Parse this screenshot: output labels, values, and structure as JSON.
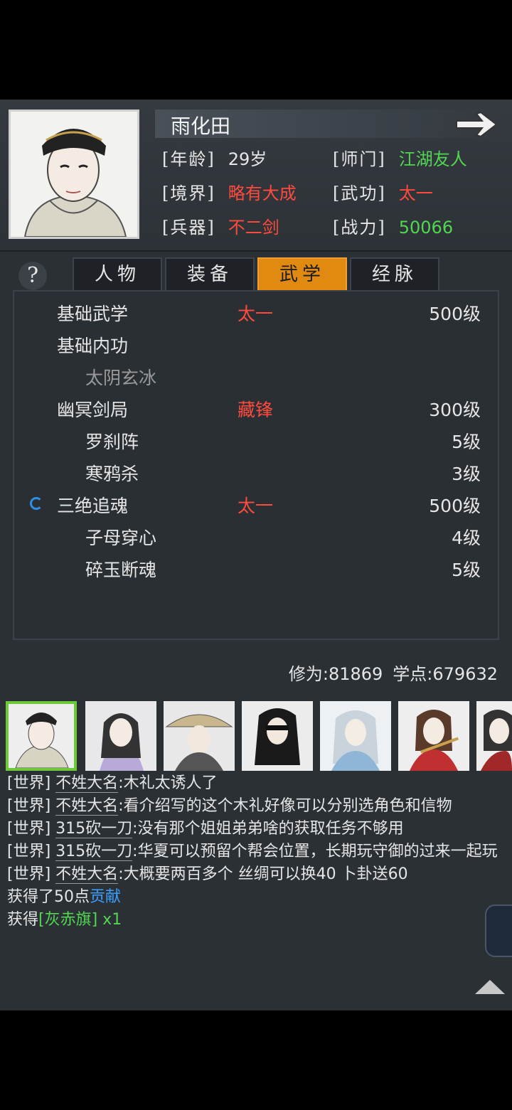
{
  "character": {
    "name": "雨化田",
    "age_label": "[年龄]",
    "age": "29岁",
    "sect_label": "[师门]",
    "sect": "江湖友人",
    "realm_label": "[境界]",
    "realm": "略有大成",
    "martial_label": "[武功]",
    "martial": "太一",
    "weapon_label": "[兵器]",
    "weapon": "不二剑",
    "power_label": "[战力]",
    "power": "50066"
  },
  "help_symbol": "?",
  "tabs": [
    {
      "label": "人物",
      "active": false
    },
    {
      "label": "装备",
      "active": false
    },
    {
      "label": "武学",
      "active": true
    },
    {
      "label": "经脉",
      "active": false
    }
  ],
  "skills": [
    {
      "name": "基础武学",
      "style": "太一",
      "level": "500级",
      "indent": false,
      "dim": false,
      "spinner": false
    },
    {
      "name": "基础内功",
      "style": "",
      "level": "",
      "indent": false,
      "dim": false,
      "spinner": false
    },
    {
      "name": "太阴玄冰",
      "style": "",
      "level": "",
      "indent": true,
      "dim": true,
      "spinner": false
    },
    {
      "name": "幽冥剑局",
      "style": "藏锋",
      "level": "300级",
      "indent": false,
      "dim": false,
      "spinner": false
    },
    {
      "name": "罗刹阵",
      "style": "",
      "level": "5级",
      "indent": true,
      "dim": false,
      "spinner": false
    },
    {
      "name": "寒鸦杀",
      "style": "",
      "level": "3级",
      "indent": true,
      "dim": false,
      "spinner": false
    },
    {
      "name": "三绝追魂",
      "style": "太一",
      "level": "500级",
      "indent": false,
      "dim": false,
      "spinner": true
    },
    {
      "name": "子母穿心",
      "style": "",
      "level": "4级",
      "indent": true,
      "dim": false,
      "spinner": false
    },
    {
      "name": "碎玉断魂",
      "style": "",
      "level": "5级",
      "indent": true,
      "dim": false,
      "spinner": false
    }
  ],
  "stats": {
    "cultivation": "修为:81869",
    "study_points": "学点:679632"
  },
  "chat": {
    "channel": "[世界]",
    "lines": [
      {
        "speaker": "不姓大名",
        "text": ":木礼太诱人了"
      },
      {
        "speaker": "不姓大名",
        "text": ":看介绍写的这个木礼好像可以分别选角色和信物"
      },
      {
        "speaker": "315砍一刀",
        "text": ":没有那个姐姐弟弟啥的获取任务不够用"
      },
      {
        "speaker": "315砍一刀",
        "text": ":华夏可以预留个帮会位置，长期玩守御的过来一起玩"
      },
      {
        "speaker": "不姓大名",
        "text": ":大概要两百多个 丝绸可以换40 卜卦送60"
      }
    ],
    "gain1_prefix": "获得了50点",
    "gain1_highlight": "贡献",
    "gain2_prefix": "获得",
    "gain2_item": "[灰赤旗]",
    "gain2_count": " x1"
  },
  "colors": {
    "accent_tab": "#e08a12",
    "red": "#ff4a3d",
    "green": "#52d652",
    "blue": "#3aa0ff",
    "selected_border": "#6dc93a"
  }
}
